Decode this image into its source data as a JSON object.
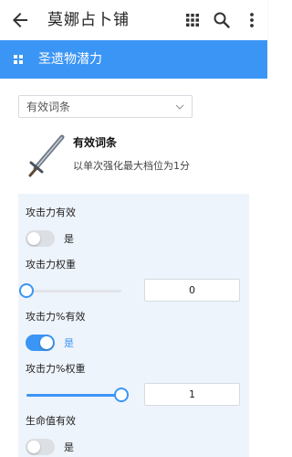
{
  "appbar": {
    "title": "莫娜占卜铺",
    "back_icon": "arrow-back-icon",
    "apps_icon": "apps-grid-icon",
    "search_icon": "search-icon",
    "more_icon": "more-vert-icon"
  },
  "section": {
    "title": "圣遗物潜力",
    "icon": "grid-icon",
    "color": "#3b95f5"
  },
  "select": {
    "value": "有效词条"
  },
  "info": {
    "icon": "sword-icon",
    "title": "有效词条",
    "description": "以单次强化最大档位为1分"
  },
  "settings": [
    {
      "label": "攻击力有效",
      "enabled": false,
      "enabled_text": "是"
    },
    {
      "label": "攻击力权重",
      "value": "0",
      "slider_fraction": 0
    },
    {
      "label": "攻击力%有效",
      "enabled": true,
      "enabled_text": "是"
    },
    {
      "label": "攻击力%权重",
      "value": "1",
      "slider_fraction": 1
    },
    {
      "label": "生命值有效",
      "enabled": false,
      "enabled_text": "是"
    }
  ]
}
